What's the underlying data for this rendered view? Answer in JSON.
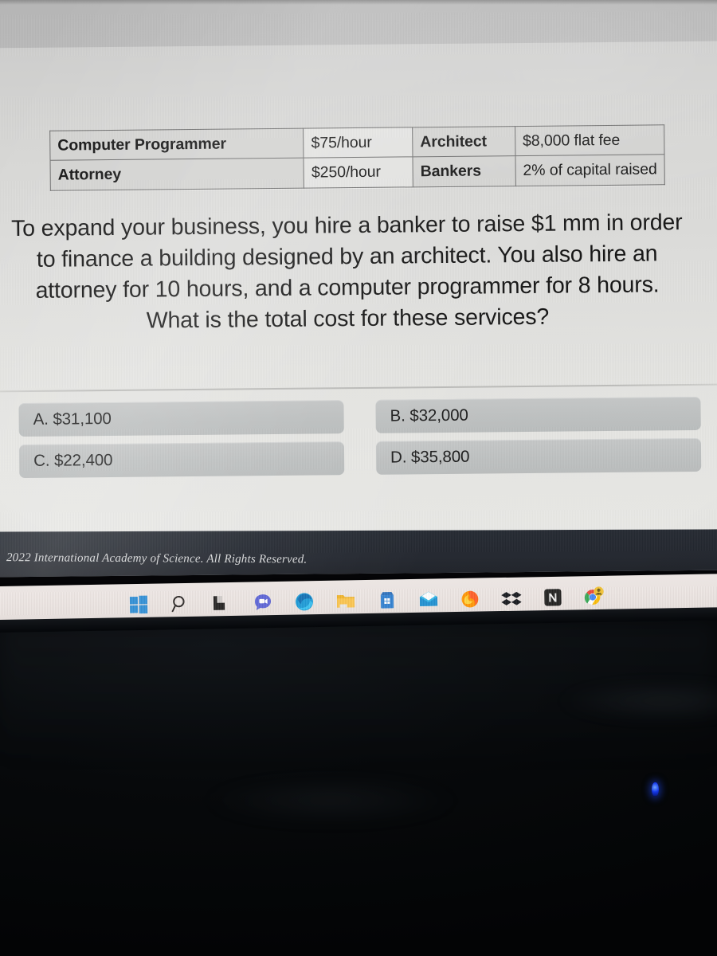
{
  "page": {
    "title": "International Academy of Science Quiz Question"
  },
  "rate_table": {
    "rows": [
      {
        "role_left": "Computer Programmer",
        "rate_left": "$75/hour",
        "role_right": "Architect",
        "rate_right": "$8,000 flat fee"
      },
      {
        "role_left": "Attorney",
        "rate_left": "$250/hour",
        "role_right": "Bankers",
        "rate_right": "2% of capital raised"
      }
    ]
  },
  "question": {
    "text": "To expand your business, you hire a banker to raise $1 mm in order to finance a building designed by an architect. You also hire an attorney for 10 hours, and a computer programmer for 8 hours. What is the total cost for these services?"
  },
  "answers": {
    "options": [
      {
        "label": "A.",
        "value": "$31,100",
        "full": "A.  $31,100"
      },
      {
        "label": "B.",
        "value": "$32,000",
        "full": "B.  $32,000"
      },
      {
        "label": "C.",
        "value": "$22,400",
        "full": "C.  $22,400"
      },
      {
        "label": "D.",
        "value": "$35,800",
        "full": "D.  $35,800"
      }
    ]
  },
  "footer": {
    "copyright": "2022 International Academy of Science.  All Rights Reserved."
  },
  "taskbar": {
    "items": [
      {
        "name": "windows-start-icon",
        "label": "Start"
      },
      {
        "name": "search-icon",
        "label": "Search"
      },
      {
        "name": "task-view-icon",
        "label": "Task View"
      },
      {
        "name": "chat-icon",
        "label": "Chat"
      },
      {
        "name": "edge-icon",
        "label": "Microsoft Edge"
      },
      {
        "name": "file-explorer-icon",
        "label": "File Explorer"
      },
      {
        "name": "microsoft-store-icon",
        "label": "Microsoft Store"
      },
      {
        "name": "mail-icon",
        "label": "Mail"
      },
      {
        "name": "firefox-icon",
        "label": "Firefox"
      },
      {
        "name": "dropbox-icon",
        "label": "Dropbox"
      },
      {
        "name": "notion-icon",
        "label": "Notion"
      },
      {
        "name": "chrome-profile-icon",
        "label": "Google Chrome"
      }
    ]
  },
  "colors": {
    "accent_blue": "#2f6fd0",
    "footer_bg": "#23272f",
    "screen_bg": "#dedede",
    "option_bg": "#bfc2c2",
    "led_blue": "#1437e8"
  }
}
